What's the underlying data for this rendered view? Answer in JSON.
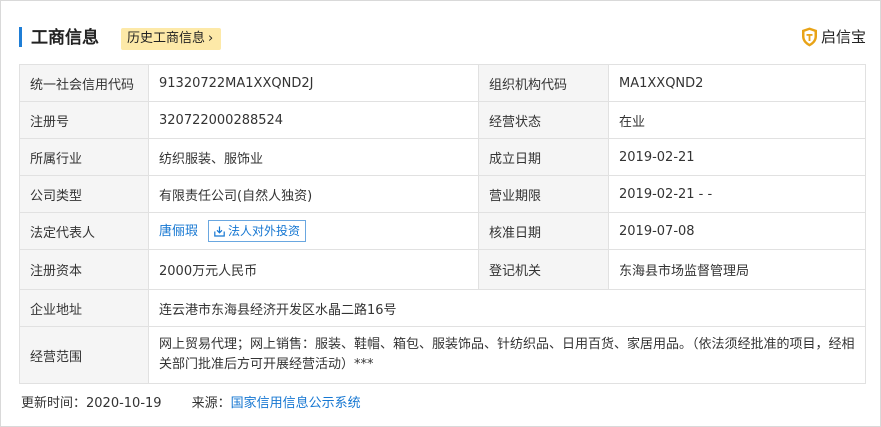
{
  "header": {
    "title": "工商信息",
    "history_button": "历史工商信息",
    "brand_name": "启信宝"
  },
  "rows": {
    "credit_code_label": "统一社会信用代码",
    "credit_code_value": "91320722MA1XXQND2J",
    "org_code_label": "组织机构代码",
    "org_code_value": "MA1XXQND2",
    "reg_no_label": "注册号",
    "reg_no_value": "320722000288524",
    "status_label": "经营状态",
    "status_value": "在业",
    "industry_label": "所属行业",
    "industry_value": "纺织服装、服饰业",
    "founded_label": "成立日期",
    "founded_value": "2019-02-21",
    "type_label": "公司类型",
    "type_value": "有限责任公司(自然人独资)",
    "term_label": "营业期限",
    "term_value": "2019-02-21 - -",
    "rep_label": "法定代表人",
    "rep_value": "唐俪瑕",
    "invest_button": "法人对外投资",
    "approved_label": "核准日期",
    "approved_value": "2019-07-08",
    "capital_label": "注册资本",
    "capital_value": "2000万元人民币",
    "authority_label": "登记机关",
    "authority_value": "东海县市场监督管理局",
    "address_label": "企业地址",
    "address_value": "连云港市东海县经济开发区水晶二路16号",
    "scope_label": "经营范围",
    "scope_value": "网上贸易代理；网上销售：服装、鞋帽、箱包、服装饰品、针纺织品、日用百货、家居用品。（依法须经批准的项目，经相关部门批准后方可开展经营活动）***"
  },
  "footer": {
    "updated_label": "更新时间：",
    "updated_value": "2020-10-19",
    "source_label": "来源：",
    "source_value": "国家信用信息公示系统"
  },
  "colors": {
    "accent": "#1f7ed6",
    "link": "#1677d2",
    "history_bg": "#fde9a8",
    "brand_shield": "#e8a317",
    "label_bg": "#f5f5f5"
  },
  "icons": {
    "brand": "shield-logo-icon",
    "history_chevron": "chevron-right-icon",
    "invest": "download-tray-icon"
  }
}
